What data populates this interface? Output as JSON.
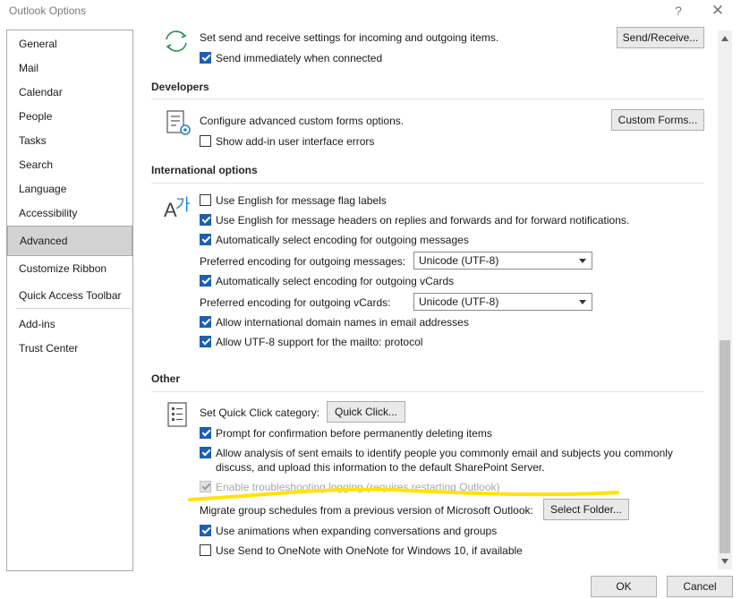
{
  "window": {
    "title": "Outlook Options",
    "help_label": "?",
    "close_label": "✕"
  },
  "sidebar": {
    "items": [
      {
        "label": "General"
      },
      {
        "label": "Mail"
      },
      {
        "label": "Calendar"
      },
      {
        "label": "People"
      },
      {
        "label": "Tasks"
      },
      {
        "label": "Search"
      },
      {
        "label": "Language"
      },
      {
        "label": "Accessibility"
      },
      {
        "label": "Advanced",
        "selected": true
      },
      {
        "label": "Customize Ribbon"
      },
      {
        "label": "Quick Access Toolbar"
      },
      {
        "label": "Add-ins"
      },
      {
        "label": "Trust Center"
      }
    ]
  },
  "send_receive": {
    "icon": "sync-arrows-icon",
    "description": "Set send and receive settings for incoming and outgoing items.",
    "button_label": "Send/Receive...",
    "send_immediately": {
      "label": "Send immediately when connected",
      "checked": true
    }
  },
  "developers": {
    "header": "Developers",
    "icon": "forms-gear-icon",
    "description": "Configure advanced custom forms options.",
    "button_label": "Custom Forms...",
    "show_addin_errors": {
      "label": "Show add-in user interface errors",
      "checked": false
    }
  },
  "international": {
    "header": "International options",
    "icon": "language-a-korean-icon",
    "icon_glyph_a": "A",
    "icon_glyph_k": "가",
    "flag_labels": {
      "label": "Use English for message flag labels",
      "checked": false
    },
    "headers_replies": {
      "label": "Use English for message headers on replies and forwards and for forward notifications.",
      "checked": true
    },
    "auto_encoding_messages": {
      "label": "Automatically select encoding for outgoing messages",
      "checked": true
    },
    "preferred_encoding_messages": {
      "label": "Preferred encoding for outgoing messages:",
      "value": "Unicode (UTF-8)"
    },
    "auto_encoding_vcards": {
      "label": "Automatically select encoding for outgoing vCards",
      "checked": true
    },
    "preferred_encoding_vcards": {
      "label": "Preferred encoding for outgoing vCards:",
      "value": "Unicode (UTF-8)"
    },
    "intl_domain_names": {
      "label": "Allow international domain names in email addresses",
      "checked": true
    },
    "utf8_mailto": {
      "label": "Allow UTF-8 support for the mailto: protocol",
      "checked": true
    }
  },
  "other": {
    "header": "Other",
    "icon": "list-checklist-icon",
    "quick_click": {
      "label": "Set Quick Click category:",
      "button_label": "Quick Click..."
    },
    "prompt_delete": {
      "label": "Prompt for confirmation before permanently deleting items",
      "checked": true
    },
    "allow_analysis": {
      "label_line1": "Allow analysis of sent emails to identify people you commonly email and subjects you commonly",
      "label_line2": "discuss, and upload this information to the default SharePoint Server.",
      "checked": true
    },
    "troubleshooting": {
      "label": "Enable troubleshooting logging (requires restarting Outlook)",
      "checked": true,
      "disabled": true
    },
    "migrate": {
      "label": "Migrate group schedules from a previous version of Microsoft Outlook:",
      "button_label": "Select Folder..."
    },
    "animations": {
      "label": "Use animations when expanding conversations and groups",
      "checked": true
    },
    "onenote": {
      "label": "Use Send to OneNote with OneNote for Windows 10, if available",
      "checked": false
    }
  },
  "footer": {
    "ok_label": "OK",
    "cancel_label": "Cancel"
  },
  "colors": {
    "highlight": "#ffe400",
    "accent": "#1f5fab"
  }
}
